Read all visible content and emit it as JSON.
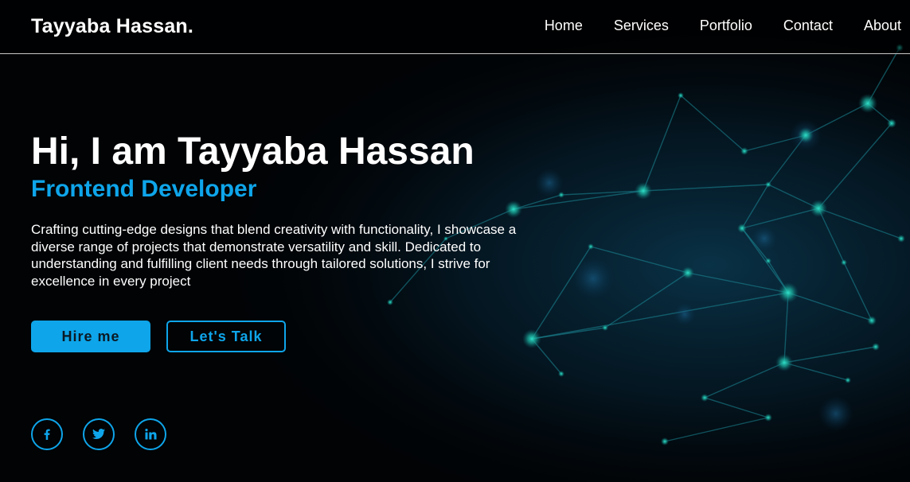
{
  "header": {
    "logo": "Tayyaba Hassan.",
    "nav": [
      {
        "label": "Home",
        "name": "nav-home"
      },
      {
        "label": "Services",
        "name": "nav-services"
      },
      {
        "label": "Portfolio",
        "name": "nav-portfolio"
      },
      {
        "label": "Contact",
        "name": "nav-contact"
      },
      {
        "label": "About",
        "name": "nav-about"
      }
    ]
  },
  "hero": {
    "title": "Hi, I am Tayyaba Hassan",
    "role": "Frontend Developer",
    "description": "Crafting cutting-edge designs that blend creativity with functionality, I showcase a diverse range of projects that demonstrate versatility and skill. Dedicated to understanding and fulfilling client needs through tailored solutions, I strive for excellence in every project",
    "buttons": {
      "hire": "Hire me",
      "talk": "Let's Talk"
    }
  },
  "social": [
    {
      "icon": "facebook-icon"
    },
    {
      "icon": "twitter-icon"
    },
    {
      "icon": "linkedin-icon"
    }
  ],
  "colors": {
    "accent": "#0ea5ea",
    "background": "#010305",
    "text": "#ffffff",
    "network": "#1fb5a8"
  }
}
